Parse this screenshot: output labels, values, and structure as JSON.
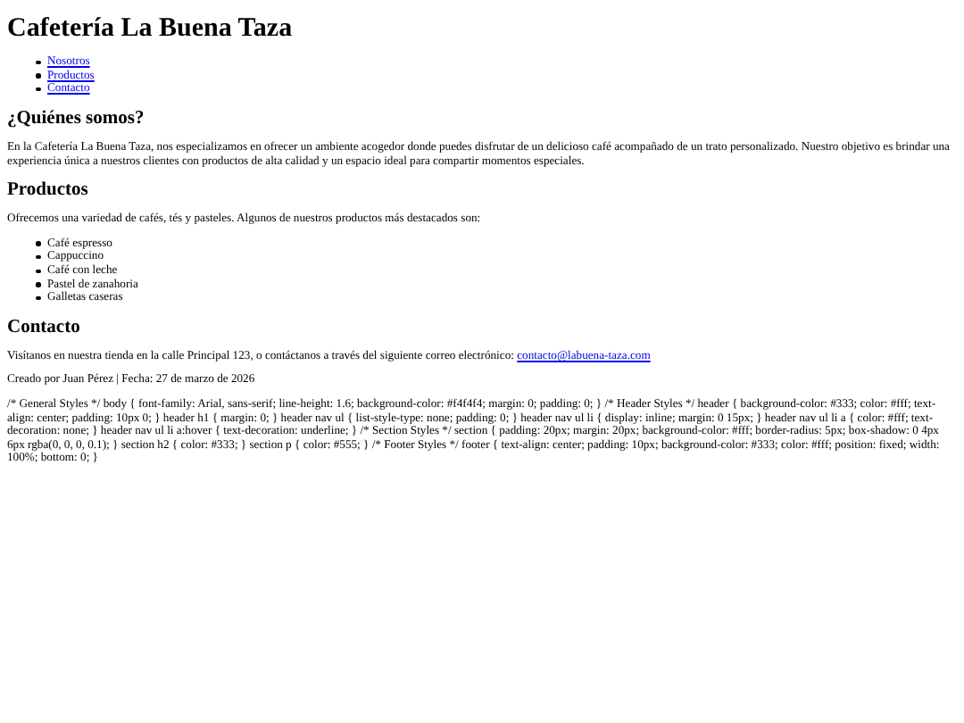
{
  "header": {
    "title": "Cafetería La Buena Taza",
    "nav": [
      "Nosotros",
      "Productos",
      "Contacto"
    ]
  },
  "sections": [
    {
      "kind": "text",
      "heading": "¿Quiénes somos?",
      "paragraph": "En la Cafetería La Buena Taza, nos especializamos en ofrecer un ambiente acogedor donde puedes disfrutar de un delicioso café acompañado de un trato personalizado. Nuestro objetivo es brindar una experiencia única a nuestros clientes con productos de alta calidad y un espacio ideal para compartir momentos especiales."
    },
    {
      "kind": "list",
      "heading": "Productos",
      "paragraph": "Ofrecemos una variedad de cafés, tés y pasteles. Algunos de nuestros productos más destacados son:",
      "items": [
        "Café espresso",
        "Cappuccino",
        "Café con leche",
        "Pastel de zanahoria",
        "Galletas caseras"
      ]
    },
    {
      "kind": "contact",
      "heading": "Contacto",
      "paragraph": "Visítanos en nuestra tienda en la calle Principal 123, o contáctanos a través del siguiente correo electrónico:",
      "link": "contacto@labuena-taza.com"
    }
  ],
  "footer": "Creado por Juan Pérez | Fecha: 27 de marzo de 2026",
  "style_text": "/* General Styles */ body { font-family: Arial, sans-serif; line-height: 1.6; background-color: #f4f4f4; margin: 0; padding: 0; } /* Header Styles */ header { background-color: #333; color: #fff; text-align: center; padding: 10px 0; } header h1 { margin: 0; } header nav ul { list-style-type: none; padding: 0; } header nav ul li { display: inline; margin: 0 15px; } header nav ul li a { color: #fff; text-decoration: none; } header nav ul li a:hover { text-decoration: underline; } /* Section Styles */ section { padding: 20px; margin: 20px; background-color: #fff; border-radius: 5px; box-shadow: 0 4px 6px rgba(0, 0, 0, 0.1); } section h2 { color: #333; } section p { color: #555; } /* Footer Styles */ footer { text-align: center; padding: 10px; background-color: #333; color: #fff; position: fixed; width: 100%; bottom: 0; }"
}
